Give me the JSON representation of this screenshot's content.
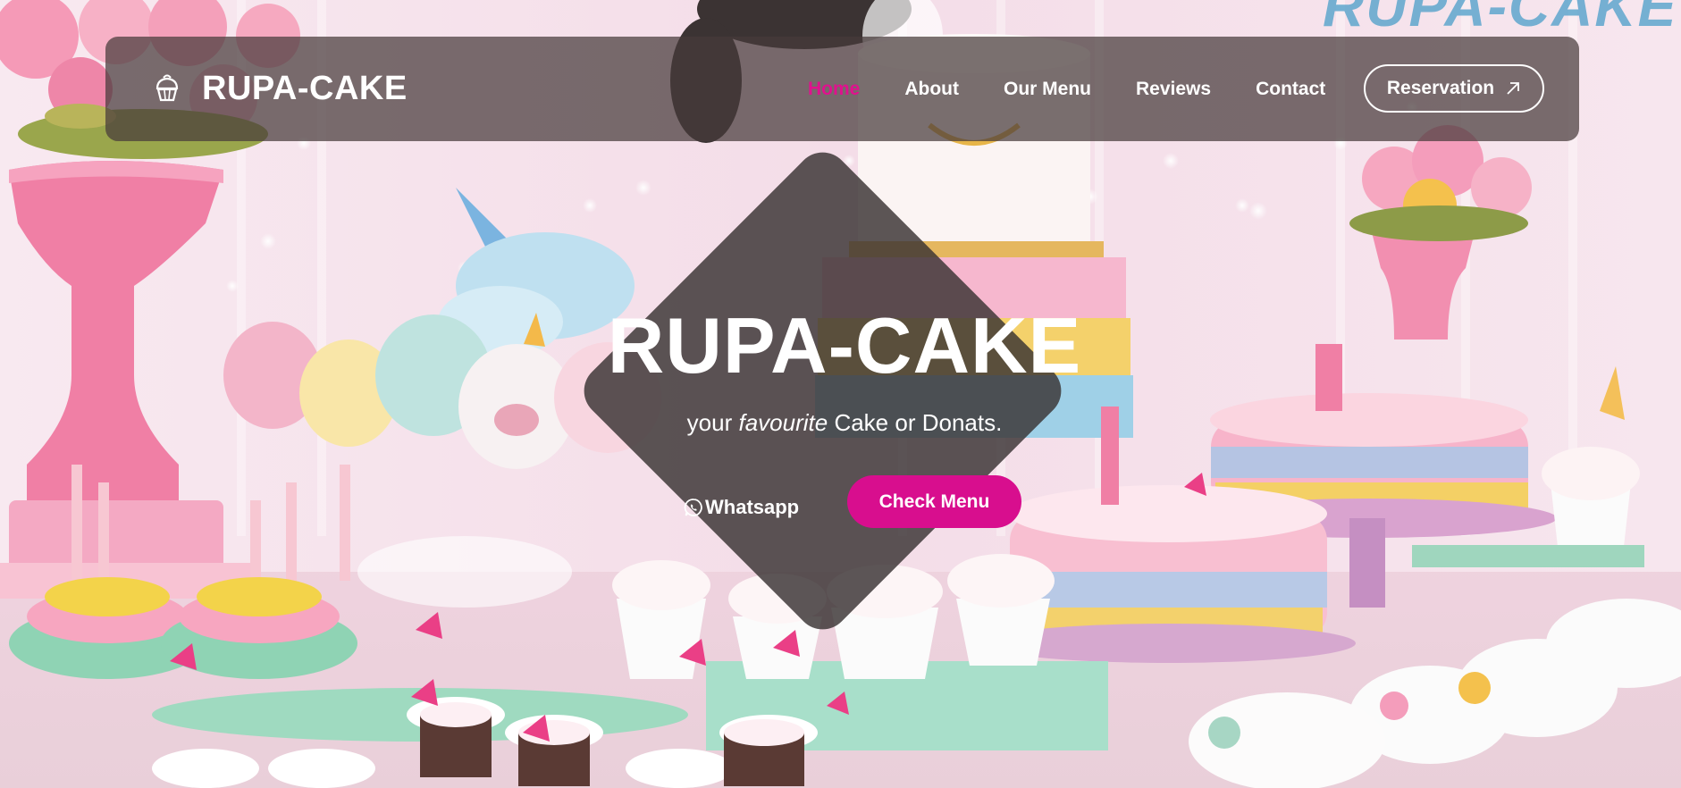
{
  "nav": {
    "brand": "RUPA-CAKE",
    "brand_icon": "cupcake-icon",
    "links": [
      {
        "label": "Home",
        "active": true
      },
      {
        "label": "About",
        "active": false
      },
      {
        "label": "Our Menu",
        "active": false
      },
      {
        "label": "Reviews",
        "active": false
      },
      {
        "label": "Contact",
        "active": false
      }
    ],
    "reservation_label": "Reservation",
    "reservation_icon": "arrow-up-right-icon"
  },
  "hero": {
    "title": "RUPA-CAKE",
    "subtitle_pre": "your ",
    "subtitle_em": "favourite",
    "subtitle_post": " Cake or Donats.",
    "whatsapp_label": "Whatsapp",
    "whatsapp_icon": "whatsapp-icon",
    "check_menu_label": "Check Menu"
  },
  "background_sign": "RUPA-CAKE",
  "colors": {
    "accent": "#d80e8e",
    "active_link": "#e0118e",
    "nav_bg": "#463a3a",
    "hero_diamond": "#383232"
  }
}
